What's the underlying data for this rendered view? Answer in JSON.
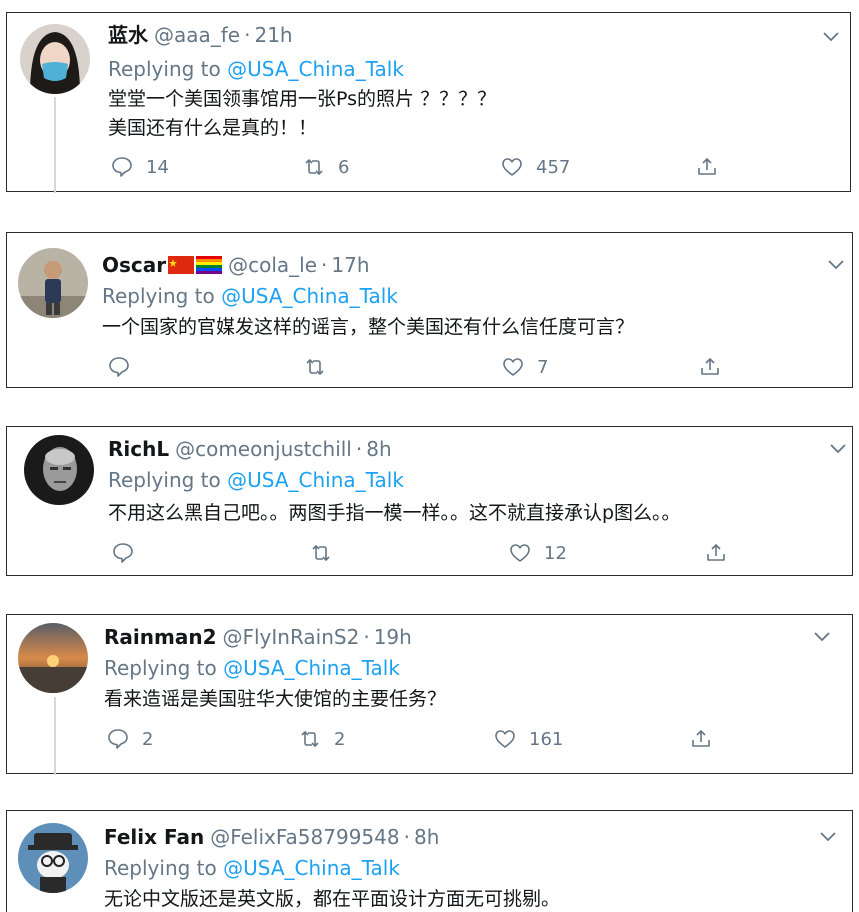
{
  "tweets": [
    {
      "name": "蓝水",
      "handle": "@aaa_fe",
      "time": "21h",
      "replying_prefix": "Replying to",
      "mention": "@USA_China_Talk",
      "lines": [
        "堂堂一个美国领事馆用一张Ps的照片 ？？？？",
        "美国还有什么是真的！！"
      ],
      "replies": "14",
      "retweets": "6",
      "likes": "457",
      "avatar": "woman-blue-mask"
    },
    {
      "name": "Oscar",
      "flags": [
        "china-flag",
        "rainbow-flag"
      ],
      "handle": "@cola_le",
      "time": "17h",
      "replying_prefix": "Replying to",
      "mention": "@USA_China_Talk",
      "lines": [
        "一个国家的官媒发这样的谣言，整个美国还有什么信任度可言？"
      ],
      "replies": "",
      "retweets": "",
      "likes": "7",
      "avatar": "man-standing"
    },
    {
      "name": "RichL",
      "handle": "@comeonjustchill",
      "time": "8h",
      "replying_prefix": "Replying to",
      "mention": "@USA_China_Talk",
      "lines": [
        "不用这么黑自己吧。。两图手指一模一样。。这不就直接承认p图么。。"
      ],
      "replies": "",
      "retweets": "",
      "likes": "12",
      "avatar": "bw-portrait"
    },
    {
      "name": "Rainman2",
      "handle": "@FlyInRainS2",
      "time": "19h",
      "replying_prefix": "Replying to",
      "mention": "@USA_China_Talk",
      "lines": [
        "看来造谣是美国驻华大使馆的主要任务？"
      ],
      "replies": "2",
      "retweets": "2",
      "likes": "161",
      "avatar": "sunset"
    },
    {
      "name": "Felix Fan",
      "handle": "@FelixFa58799548",
      "time": "8h",
      "replying_prefix": "Replying to",
      "mention": "@USA_China_Talk",
      "lines": [
        "无论中文版还是英文版，都在平面设计方面无可挑剔。"
      ],
      "avatar": "cartoon-character"
    }
  ],
  "colors": {
    "link": "#1da1f2",
    "secondary": "#657786",
    "text": "#14171a",
    "border": "#2b2b2b"
  },
  "icons": [
    "reply-icon",
    "retweet-icon",
    "like-icon",
    "share-icon",
    "chevron-down-icon"
  ]
}
